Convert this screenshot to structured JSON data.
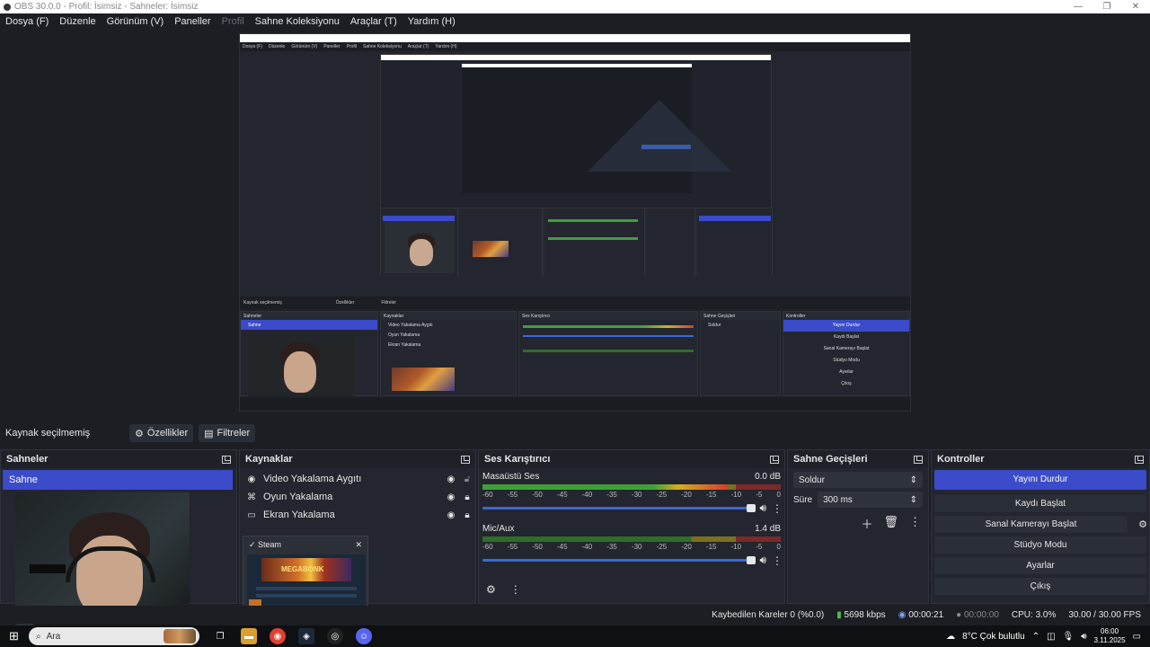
{
  "window": {
    "title": "OBS 30.0.0 - Profil: İsimsiz - Sahneler: İsimsiz"
  },
  "menu": [
    "Dosya (F)",
    "Düzenle",
    "Görünüm (V)",
    "Paneller",
    "Profil",
    "Sahne Koleksiyonu",
    "Araçlar (T)",
    "Yardım (H)"
  ],
  "toolbar": {
    "no_source": "Kaynak seçilmemiş",
    "properties": "Özellikler",
    "filters": "Filtreler"
  },
  "scenes": {
    "title": "Sahneler",
    "items": [
      "Sahne"
    ]
  },
  "sources": {
    "title": "Kaynaklar",
    "items": [
      {
        "icon": "camera-icon",
        "label": "Video Yakalama Aygıtı",
        "locked": false
      },
      {
        "icon": "gamepad-icon",
        "label": "Oyun Yakalama",
        "locked": true
      },
      {
        "icon": "monitor-icon",
        "label": "Ekran Yakalama",
        "locked": true
      }
    ]
  },
  "mixer": {
    "title": "Ses Karıştırıcı",
    "channels": [
      {
        "name": "Masaüstü Ses",
        "db": "0.0 dB",
        "level": 0.82
      },
      {
        "name": "Mic/Aux",
        "db": "1.4 dB",
        "level": 0.0
      }
    ],
    "scale": [
      "-60",
      "-55",
      "-50",
      "-45",
      "-40",
      "-35",
      "-30",
      "-25",
      "-20",
      "-15",
      "-10",
      "-5",
      "0"
    ]
  },
  "transitions": {
    "title": "Sahne Geçişleri",
    "selected": "Soldur",
    "duration_label": "Süre",
    "duration_value": "300 ms"
  },
  "controls": {
    "title": "Kontroller",
    "buttons": [
      "Yayını Durdur",
      "Kaydı Başlat",
      "Sanal Kamerayı Başlat",
      "Stüdyo Modu",
      "Ayarlar",
      "Çıkış"
    ]
  },
  "steam_popup": {
    "title": "Steam",
    "game_art": "MEGABONK"
  },
  "status": {
    "dropped": "Kaybedilen Kareler 0 (%0.0)",
    "bitrate": "5698 kbps",
    "stream_time": "00:00:21",
    "rec_time": "00:00:00",
    "cpu": "CPU: 3.0%",
    "fps": "30.00 / 30.00 FPS"
  },
  "taskbar": {
    "search": "Ara",
    "weather": "8°C  Çok bulutlu",
    "time": "06:00",
    "date": "3.11.2025"
  },
  "preview_nested": {
    "menu": [
      "Dosya (F)",
      "Düzenle",
      "Görünüm (V)",
      "Paneller",
      "Profil",
      "Sahne Koleksiyonu",
      "Araçlar (T)",
      "Yardım (H)"
    ],
    "scene": "Sahne",
    "sources": [
      "Video Yakalama Aygıtı",
      "Oyun Yakalama",
      "Ekran Yakalama"
    ],
    "controls": [
      "Yayını Durdur",
      "Kaydı Başlat",
      "Sanal Kamerayı Başlat",
      "Stüdyo Modu",
      "Ayarlar",
      "Çıkış"
    ]
  },
  "colors": {
    "accent": "#3b4bc9",
    "bg": "#1c1e24",
    "panel": "#23262e"
  }
}
